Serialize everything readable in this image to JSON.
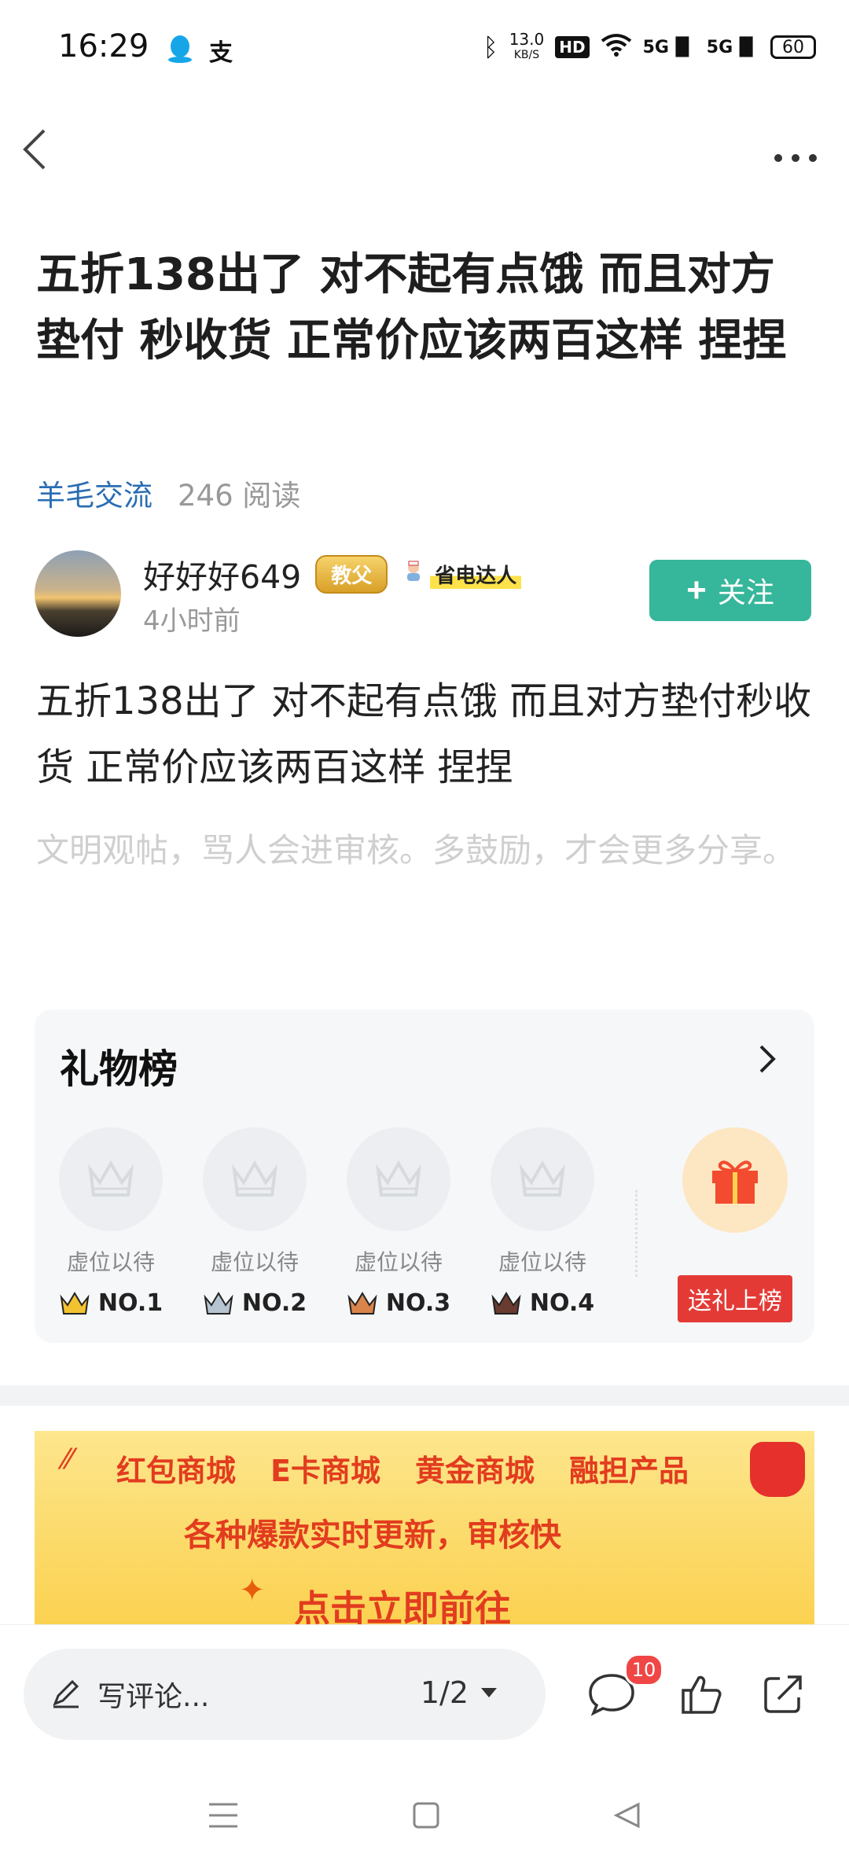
{
  "status_bar": {
    "time": "16:29",
    "speed": "13.0",
    "speed_unit": "KB/S",
    "hd_label": "HD",
    "sig1": "5G",
    "sig2": "5G",
    "battery": "60"
  },
  "post": {
    "title": "五折138出了 对不起有点饿 而且对方垫付 秒收货 正常价应该两百这样 捏捏",
    "tag": "羊毛交流",
    "reads": "246 阅读",
    "author": {
      "name": "好好好649",
      "badge": "教父",
      "role": "省电达人",
      "time": "4小时前"
    },
    "follow_label": "关注",
    "body": "五折138出了 对不起有点饿 而且对方垫付秒收货 正常价应该两百这样 捏捏",
    "hint": "文明观帖，骂人会进审核。多鼓励，才会更多分享。"
  },
  "gift_board": {
    "title": "礼物榜",
    "slots": [
      {
        "label": "虚位以待",
        "rank": "NO.1",
        "crown_color": "#f2c230"
      },
      {
        "label": "虚位以待",
        "rank": "NO.2",
        "crown_color": "#b6c3d1"
      },
      {
        "label": "虚位以待",
        "rank": "NO.3",
        "crown_color": "#d9844a"
      },
      {
        "label": "虚位以待",
        "rank": "NO.4",
        "crown_color": "#6a3b30"
      }
    ],
    "send_label": "送礼上榜"
  },
  "banner": {
    "items": [
      "红包商城",
      "E卡商城",
      "黄金商城",
      "融担产品"
    ],
    "line2": "各种爆款实时更新，审核快",
    "line3": "点击立即前往"
  },
  "bottom_bar": {
    "comment_placeholder": "写评论...",
    "page_indicator": "1/2",
    "comment_count": "10"
  },
  "colors": {
    "accent": "#36b69a",
    "tag": "#2a6db3",
    "red": "#e43a36"
  }
}
